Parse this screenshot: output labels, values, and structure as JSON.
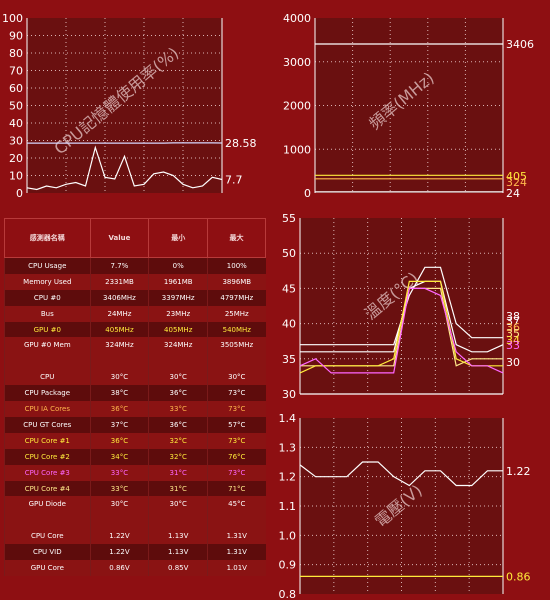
{
  "colors": {
    "background": "#8e0f12",
    "plot": "#6a1010",
    "grid": "#d9b3b3",
    "white": "#ffffff",
    "yellow": "#ffeb3b",
    "orange": "#ffb74d",
    "pink": "#ff66ff",
    "light_yellow": "#ffe98a"
  },
  "chart_data": [
    {
      "id": "cpu-memory",
      "type": "line",
      "title": "CPU記憶體使用率(%)",
      "ylim": [
        0,
        100
      ],
      "yticks": [
        "0",
        "10",
        "20",
        "30",
        "40",
        "50",
        "60",
        "70",
        "80",
        "90",
        "100"
      ],
      "series": [
        {
          "color": "#d8d8ff",
          "values": [
            28.5,
            28.5,
            28.5,
            28.5,
            28.5,
            28.5,
            28.5,
            28.5,
            28.5,
            28.5,
            28.5,
            28.5,
            28.5,
            28.5,
            28.5,
            28.6,
            28.6,
            28.6,
            28.6,
            28.6,
            28.58
          ],
          "label": "28.58"
        },
        {
          "color": "#ffffff",
          "values": [
            3,
            2,
            4,
            3,
            5,
            6,
            4,
            26,
            9,
            8,
            21,
            4,
            5,
            11,
            12,
            10,
            5,
            3,
            4,
            9,
            7.7
          ],
          "label": "7.7"
        }
      ]
    },
    {
      "id": "frequency",
      "type": "line",
      "title": "頻率(MHz)",
      "ylim": [
        0,
        4000
      ],
      "yticks": [
        "0",
        "1000",
        "2000",
        "3000",
        "4000"
      ],
      "series": [
        {
          "color": "#ffffff",
          "values": [
            3406,
            3406
          ],
          "label": "3406"
        },
        {
          "color": "#ffeb3b",
          "values": [
            405,
            405
          ],
          "label": "405"
        },
        {
          "color": "#ffb74d",
          "values": [
            324,
            324
          ],
          "label": "324"
        },
        {
          "color": "#ffffff",
          "values": [
            24,
            24
          ],
          "label": "24"
        }
      ]
    },
    {
      "id": "temperature",
      "type": "line",
      "title": "溫度(°C)",
      "ylim": [
        30,
        55
      ],
      "yticks": [
        "30",
        "35",
        "40",
        "45",
        "50",
        "55"
      ],
      "series": [
        {
          "color": "#ffffff",
          "values": [
            37,
            37,
            37,
            37,
            37,
            37,
            37,
            44,
            48,
            48,
            40,
            38,
            38,
            38
          ],
          "label": "38"
        },
        {
          "color": "#ffffff",
          "values": [
            36,
            36,
            36,
            36,
            36,
            36,
            36,
            45,
            46,
            46,
            37,
            36,
            36,
            37
          ],
          "label": "37"
        },
        {
          "color": "#ffe98a",
          "values": [
            34,
            34,
            34,
            34,
            34,
            34,
            34,
            45,
            45,
            45,
            34,
            35,
            35,
            35
          ],
          "label": "35"
        },
        {
          "color": "#ffeb3b",
          "values": [
            33,
            34,
            34,
            34,
            34,
            34,
            35,
            46,
            46,
            46,
            35,
            34,
            34,
            34
          ],
          "label": "34"
        },
        {
          "color": "#ff66ff",
          "values": [
            34,
            35,
            33,
            33,
            33,
            33,
            33,
            45,
            45,
            44,
            36,
            34,
            34,
            33
          ],
          "label": "33"
        },
        {
          "color": "#ffffff",
          "values": [
            30,
            30,
            30,
            30,
            30,
            30,
            30,
            30,
            30,
            30,
            30,
            30,
            30,
            30
          ],
          "label": "30"
        }
      ],
      "labels_order": [
        "38",
        "37",
        "36",
        "35",
        "34",
        "33",
        "30"
      ]
    },
    {
      "id": "voltage",
      "type": "line",
      "title": "電壓(V)",
      "ylim": [
        0.8,
        1.4
      ],
      "yticks": [
        "0.8",
        "0.9",
        "1.0",
        "1.1",
        "1.2",
        "1.3",
        "1.4"
      ],
      "series": [
        {
          "color": "#ffffff",
          "values": [
            1.24,
            1.2,
            1.2,
            1.2,
            1.25,
            1.25,
            1.2,
            1.17,
            1.22,
            1.22,
            1.17,
            1.17,
            1.22,
            1.22
          ],
          "label": "1.22"
        },
        {
          "color": "#ffeb3b",
          "values": [
            0.86,
            0.86
          ],
          "label": "0.86"
        }
      ]
    }
  ],
  "table": {
    "headers": [
      "感測器名稱",
      "Value",
      "最小",
      "最大"
    ],
    "rows": [
      {
        "name": "CPU Usage",
        "value": "7.7%",
        "min": "0%",
        "max": "100%",
        "color": "#ffffff"
      },
      {
        "name": "Memory Used",
        "value": "2331MB",
        "min": "1961MB",
        "max": "3896MB",
        "color": "#ffffff"
      },
      {
        "name": "CPU #0",
        "value": "3406MHz",
        "min": "3397MHz",
        "max": "4797MHz",
        "color": "#ffffff"
      },
      {
        "name": "Bus",
        "value": "24MHz",
        "min": "23MHz",
        "max": "25MHz",
        "color": "#ffffff"
      },
      {
        "name": "GPU #0",
        "value": "405MHz",
        "min": "405MHz",
        "max": "540MHz",
        "color": "#ffeb3b"
      },
      {
        "name": "GPU #0 Mem",
        "value": "324MHz",
        "min": "324MHz",
        "max": "3505MHz",
        "color": "#ffffff"
      },
      {
        "spacer": true
      },
      {
        "name": "CPU",
        "value": "30°C",
        "min": "30°C",
        "max": "30°C",
        "color": "#ffffff"
      },
      {
        "name": "CPU Package",
        "value": "38°C",
        "min": "36°C",
        "max": "73°C",
        "color": "#ffffff"
      },
      {
        "name": "CPU IA Cores",
        "value": "36°C",
        "min": "33°C",
        "max": "73°C",
        "color": "#ffb74d"
      },
      {
        "name": "CPU GT Cores",
        "value": "37°C",
        "min": "36°C",
        "max": "57°C",
        "color": "#ffffff"
      },
      {
        "name": "CPU Core #1",
        "value": "36°C",
        "min": "32°C",
        "max": "73°C",
        "color": "#ffeb3b"
      },
      {
        "name": "CPU Core #2",
        "value": "34°C",
        "min": "32°C",
        "max": "76°C",
        "color": "#ffeb3b"
      },
      {
        "name": "CPU Core #3",
        "value": "33°C",
        "min": "31°C",
        "max": "73°C",
        "color": "#ff66ff"
      },
      {
        "name": "CPU Core #4",
        "value": "33°C",
        "min": "31°C",
        "max": "71°C",
        "color": "#ffe98a"
      },
      {
        "name": "GPU Diode",
        "value": "30°C",
        "min": "30°C",
        "max": "45°C",
        "color": "#ffffff"
      },
      {
        "spacer": true
      },
      {
        "name": "CPU Core",
        "value": "1.22V",
        "min": "1.13V",
        "max": "1.31V",
        "color": "#ffffff"
      },
      {
        "name": "CPU VID",
        "value": "1.22V",
        "min": "1.13V",
        "max": "1.31V",
        "color": "#ffffff"
      },
      {
        "name": "GPU Core",
        "value": "0.86V",
        "min": "0.85V",
        "max": "1.01V",
        "color": "#ffffff"
      }
    ]
  }
}
